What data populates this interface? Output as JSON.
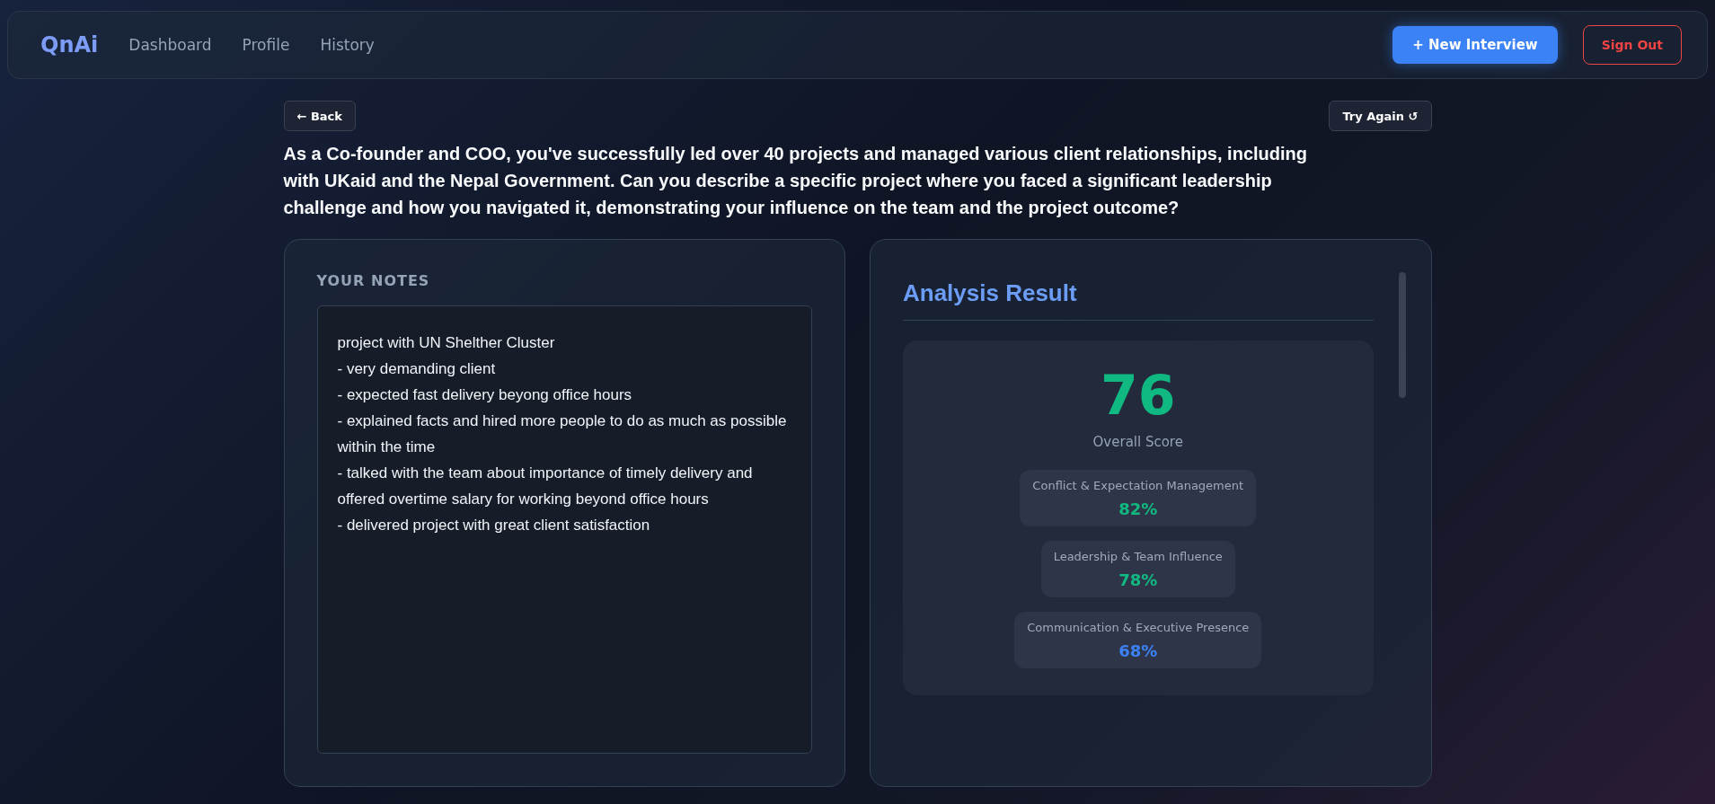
{
  "nav": {
    "logo": "QnAi",
    "links": [
      {
        "label": "Dashboard",
        "selected": false
      },
      {
        "label": "Profile",
        "selected": false
      },
      {
        "label": "History",
        "selected": false
      }
    ],
    "new_button": "+ New Interview",
    "signout_button": "Sign Out"
  },
  "back_button": "← Back",
  "retry_button": "Try Again ↺",
  "question": "As a Co-founder and COO, you've successfully led over 40 projects and managed various client relationships, including with UKaid and the Nepal Government. Can you describe a specific project where you faced a significant leadership challenge and how you navigated it, demonstrating your influence on the team and the project outcome?",
  "notes": {
    "title": "YOUR NOTES",
    "value": "project with UN Shelther Cluster\n- very demanding client\n- expected fast delivery beyong office hours\n- explained facts and hired more people to do as much as possible within the time\n- talked with the team about importance of timely delivery and offered overtime salary for working beyond office hours\n- delivered project with great client satisfaction"
  },
  "analysis": {
    "title": "Analysis Result",
    "score": "76",
    "score_label": "Overall Score",
    "metrics": [
      {
        "label": "Conflict & Expectation Management",
        "value": "82%",
        "color": "#10b981"
      },
      {
        "label": "Leadership & Team Influence",
        "value": "78%",
        "color": "#10b981"
      },
      {
        "label": "Communication & Executive Presence",
        "value": "68%",
        "color": "#3b82f6"
      }
    ]
  }
}
